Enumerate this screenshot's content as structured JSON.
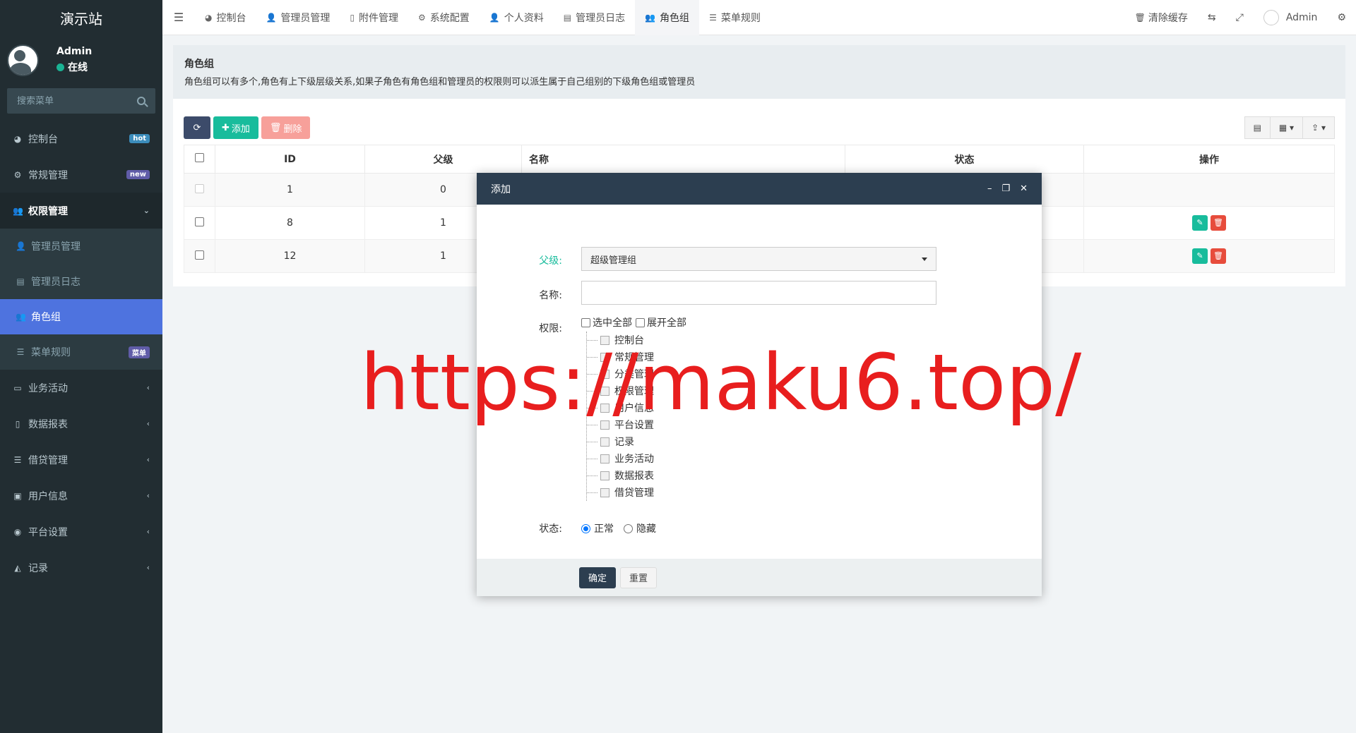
{
  "sidebar": {
    "brand": "演示站",
    "user_name": "Admin",
    "user_status": "在线",
    "search_placeholder": "搜索菜单",
    "items": [
      {
        "label": "控制台",
        "badge": "hot"
      },
      {
        "label": "常规管理",
        "badge": "new"
      },
      {
        "label": "权限管理"
      },
      {
        "label": "管理员管理"
      },
      {
        "label": "管理员日志"
      },
      {
        "label": "角色组"
      },
      {
        "label": "菜单规则",
        "badge": "菜单"
      },
      {
        "label": "业务活动"
      },
      {
        "label": "数据报表"
      },
      {
        "label": "借贷管理"
      },
      {
        "label": "用户信息"
      },
      {
        "label": "平台设置"
      },
      {
        "label": "记录"
      }
    ]
  },
  "header": {
    "tabs": [
      "控制台",
      "管理员管理",
      "附件管理",
      "系统配置",
      "个人资料",
      "管理员日志",
      "角色组",
      "菜单规则"
    ],
    "clear_cache": "清除缓存",
    "user": "Admin"
  },
  "intro": {
    "title": "角色组",
    "desc": "角色组可以有多个,角色有上下级层级关系,如果子角色有角色组和管理员的权限则可以派生属于自己组别的下级角色组或管理员"
  },
  "toolbar": {
    "add": "添加",
    "delete": "删除"
  },
  "table": {
    "columns": [
      "ID",
      "父级",
      "名称",
      "状态",
      "操作"
    ],
    "rows": [
      {
        "id": "1",
        "parent": "0"
      },
      {
        "id": "8",
        "parent": "1"
      },
      {
        "id": "12",
        "parent": "1"
      }
    ]
  },
  "modal": {
    "title": "添加",
    "parent_label": "父级:",
    "parent_value": "超级管理组",
    "name_label": "名称:",
    "perm_label": "权限:",
    "select_all": "选中全部",
    "expand_all": "展开全部",
    "tree": [
      "控制台",
      "常规管理",
      "分类管理",
      "权限管理",
      "用户信息",
      "平台设置",
      "记录",
      "业务活动",
      "数据报表",
      "借贷管理"
    ],
    "status_label": "状态:",
    "status_normal": "正常",
    "status_hidden": "隐藏",
    "ok": "确定",
    "reset": "重置"
  },
  "watermark": "https://maku6.top/"
}
